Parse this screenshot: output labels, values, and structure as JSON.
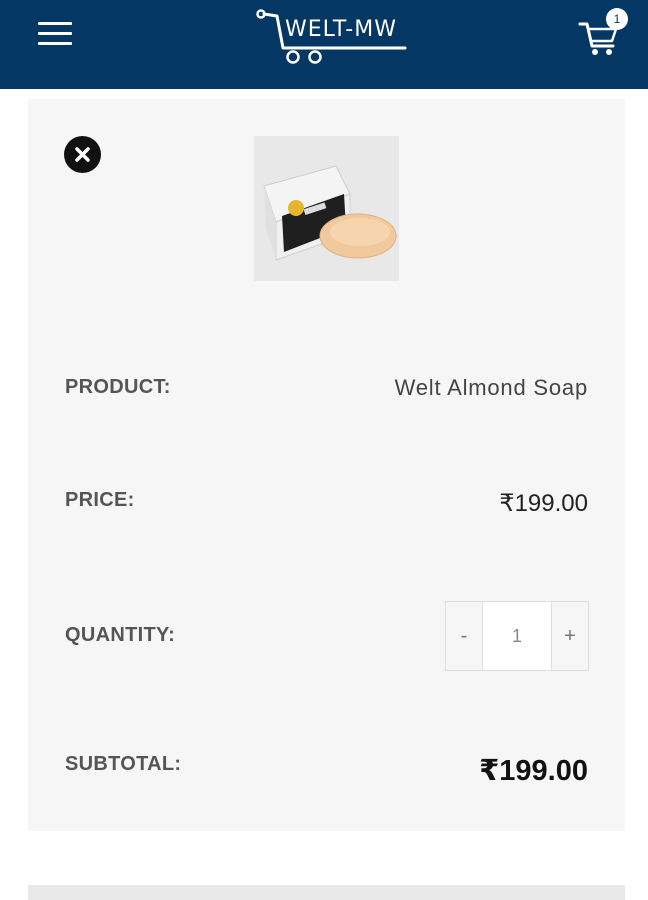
{
  "header": {
    "logo_text": "WELT-MW",
    "cart_count": "1",
    "background": "#043763"
  },
  "cart_item": {
    "image_icon": "welt-almond-soap-product-image",
    "product_label": "PRODUCT:",
    "product_name": "Welt Almond Soap",
    "price_label": "PRICE:",
    "price": "₹199.00",
    "quantity_label": "QUANTITY:",
    "quantity_minus": "-",
    "quantity_value": "1",
    "quantity_plus": "+",
    "subtotal_label": "SUBTOTAL:",
    "subtotal": "₹199.00"
  }
}
